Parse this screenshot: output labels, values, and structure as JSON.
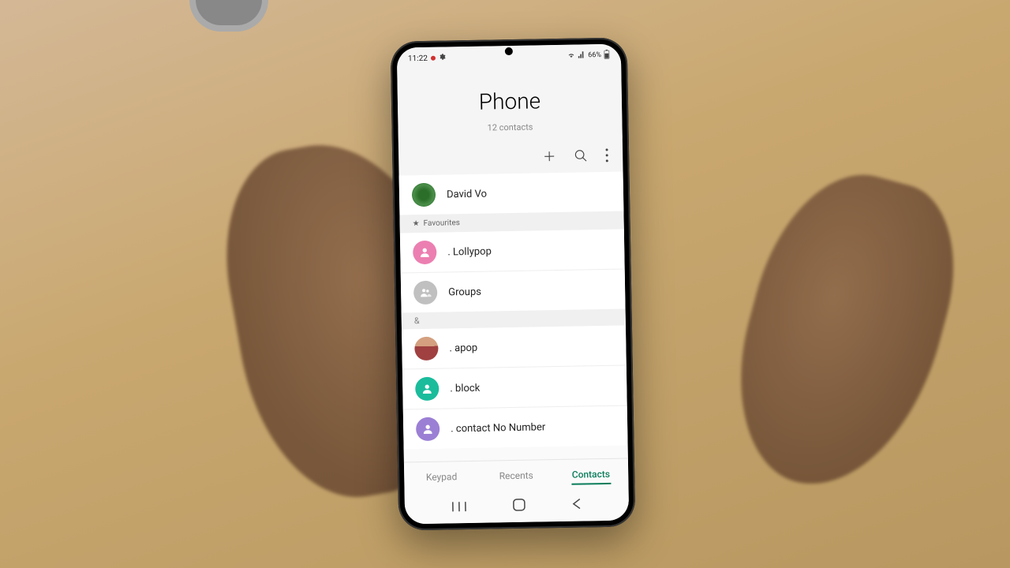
{
  "status": {
    "time": "11:22",
    "battery": "66%"
  },
  "header": {
    "title": "Phone",
    "subtitle": "12 contacts"
  },
  "profile": {
    "name": "David Vo"
  },
  "sections": {
    "favourites_label": "Favourites",
    "letter_amp": "&"
  },
  "contacts": {
    "lollypop": ". Lollypop",
    "groups": "Groups",
    "apop": ". apop",
    "block": ". block",
    "no_number": ". contact No Number"
  },
  "tabs": {
    "keypad": "Keypad",
    "recents": "Recents",
    "contacts": "Contacts"
  }
}
